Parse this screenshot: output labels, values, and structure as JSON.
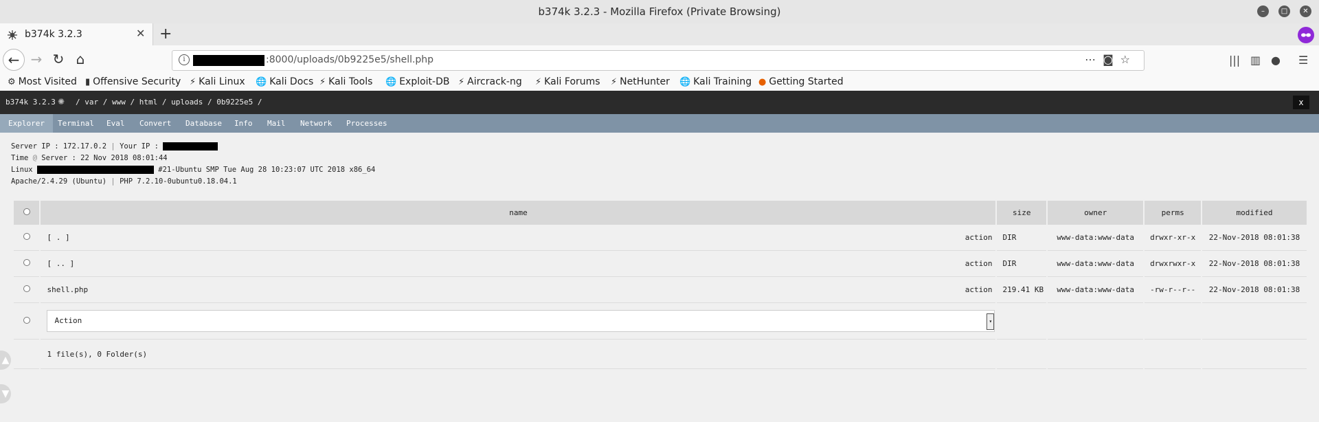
{
  "window": {
    "title": "b374k 3.2.3 - Mozilla Firefox (Private Browsing)"
  },
  "tab": {
    "title": "b374k 3.2.3"
  },
  "address": {
    "url_suffix": ":8000/uploads/0b9225e5/shell.php"
  },
  "bookmarks": [
    {
      "label": "Most Visited",
      "icon": "gear-icon"
    },
    {
      "label": "Offensive Security",
      "icon": "offsec-icon"
    },
    {
      "label": "Kali Linux",
      "icon": "kali-icon"
    },
    {
      "label": "Kali Docs",
      "icon": "globe-icon"
    },
    {
      "label": "Kali Tools",
      "icon": "kali-icon"
    },
    {
      "label": "Exploit-DB",
      "icon": "globe-icon"
    },
    {
      "label": "Aircrack-ng",
      "icon": "aircrack-icon"
    },
    {
      "label": "Kali Forums",
      "icon": "kali-icon"
    },
    {
      "label": "NetHunter",
      "icon": "kali-icon"
    },
    {
      "label": "Kali Training",
      "icon": "globe-icon"
    },
    {
      "label": "Getting Started",
      "icon": "firefox-icon"
    }
  ],
  "header": {
    "brand": "b374k 3.2.3",
    "path": "/ var / www / html / uploads / 0b9225e5 /",
    "close": "x"
  },
  "menu": [
    "Explorer",
    "Terminal",
    "Eval",
    "Convert",
    "Database",
    "Info",
    "Mail",
    "Network",
    "Processes"
  ],
  "sysinfo": {
    "server_ip_label": "Server IP : 172.17.0.2",
    "sep": "|",
    "your_ip_label": "Your IP :",
    "time_prefix": "Time",
    "at": "@",
    "time_suffix": "Server : 22 Nov 2018 08:01:44",
    "linux_prefix": "Linux",
    "kernel": "#21-Ubuntu SMP Tue Aug 28 10:23:07 UTC 2018 x86_64",
    "apache": "Apache/2.4.29 (Ubuntu)",
    "php": "PHP 7.2.10-0ubuntu0.18.04.1"
  },
  "table": {
    "headers": {
      "name": "name",
      "size": "size",
      "owner": "owner",
      "perms": "perms",
      "modified": "modified"
    },
    "rows": [
      {
        "name": "[ . ]",
        "action": "action",
        "size": "DIR",
        "owner": "www-data:www-data",
        "perms": "drwxr-xr-x",
        "modified": "22-Nov-2018 08:01:38"
      },
      {
        "name": "[ .. ]",
        "action": "action",
        "size": "DIR",
        "owner": "www-data:www-data",
        "perms": "drwxrwxr-x",
        "modified": "22-Nov-2018 08:01:38"
      },
      {
        "name": "shell.php",
        "action": "action",
        "size": "219.41 KB",
        "owner": "www-data:www-data",
        "perms": "-rw-r--r--",
        "modified": "22-Nov-2018 08:01:38"
      }
    ],
    "action_select": "Action",
    "summary": "1 file(s), 0 Folder(s)"
  }
}
